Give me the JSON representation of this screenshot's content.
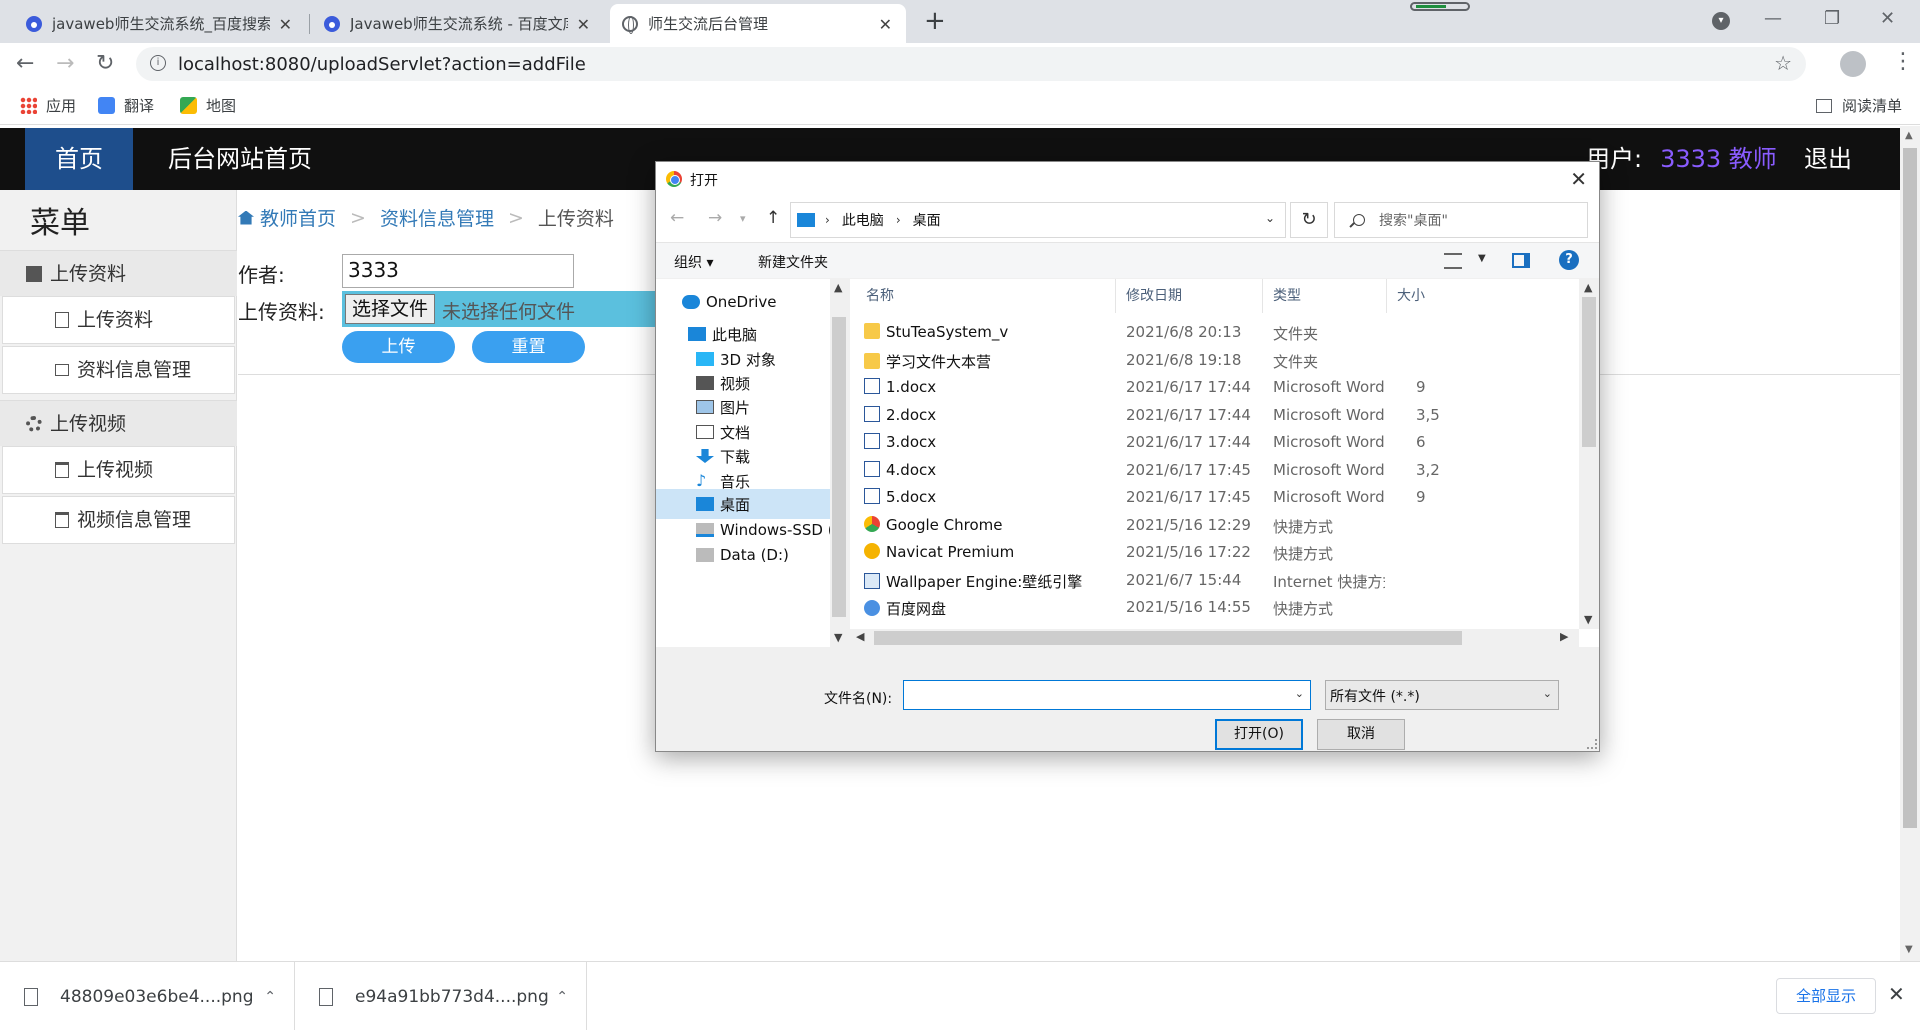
{
  "browser": {
    "tabs": [
      {
        "title": "javaweb师生交流系统_百度搜索",
        "close": "✕"
      },
      {
        "title": "Javaweb师生交流系统 - 百度文库",
        "close": "✕"
      },
      {
        "title": "师生交流后台管理",
        "close": "✕"
      }
    ],
    "new_tab": "+",
    "window_controls": {
      "minimize": "—",
      "restore": "❐",
      "close": "✕"
    },
    "url": "localhost:8080/uploadServlet?action=addFile",
    "bookmarks": [
      {
        "label": "应用",
        "icon": "apps-grid-icon"
      },
      {
        "label": "翻译",
        "icon": "translate-icon"
      },
      {
        "label": "地图",
        "icon": "maps-icon"
      }
    ],
    "reading_list": "阅读清单"
  },
  "page": {
    "nav": {
      "home": "首页",
      "admin_home": "后台网站首页",
      "user_label": "用户:",
      "user_value": "3333 教师",
      "logout": "退出"
    },
    "menu_title": "菜单",
    "menu": {
      "section1": "上传资料",
      "item_upload": "上传资料",
      "item_manage": "资料信息管理",
      "section2": "上传视频",
      "item_video_upload": "上传视频",
      "item_video_manage": "视频信息管理"
    },
    "breadcrumb": [
      "教师首页",
      "资料信息管理",
      "上传资料"
    ],
    "form": {
      "author_label": "作者:",
      "author_value": "3333",
      "file_label": "上传资料:",
      "choose_btn": "选择文件",
      "no_file": "未选择任何文件",
      "upload_btn": "上传",
      "reset_btn": "重置"
    }
  },
  "dialog": {
    "title": "打开",
    "path": [
      "此电脑",
      "桌面"
    ],
    "search_placeholder": "搜索\"桌面\"",
    "organize": "组织 ▾",
    "new_folder": "新建文件夹",
    "help": "?",
    "nav_tree": [
      {
        "label": "OneDrive",
        "icon": "onedrive-icon",
        "selected": false
      },
      {
        "label": "此电脑",
        "icon": "this-pc-icon",
        "selected": false
      },
      {
        "label": "3D 对象",
        "icon": "3d-objects-icon",
        "selected": false
      },
      {
        "label": "视频",
        "icon": "videos-icon",
        "selected": false
      },
      {
        "label": "图片",
        "icon": "pictures-icon",
        "selected": false
      },
      {
        "label": "文档",
        "icon": "documents-icon",
        "selected": false
      },
      {
        "label": "下载",
        "icon": "downloads-icon",
        "selected": false
      },
      {
        "label": "音乐",
        "icon": "music-icon",
        "selected": false
      },
      {
        "label": "桌面",
        "icon": "desktop-icon",
        "selected": true
      },
      {
        "label": "Windows-SSD (",
        "icon": "drive-c-icon",
        "selected": false
      },
      {
        "label": "Data (D:)",
        "icon": "drive-d-icon",
        "selected": false
      }
    ],
    "columns": {
      "name": "名称",
      "date": "修改日期",
      "type": "类型",
      "size": "大小"
    },
    "files": [
      {
        "name": "StuTeaSystem_v",
        "date": "2021/6/8 20:13",
        "type": "文件夹",
        "size": "",
        "icon": "folder"
      },
      {
        "name": "学习文件大本营",
        "date": "2021/6/8 19:18",
        "type": "文件夹",
        "size": "",
        "icon": "folder"
      },
      {
        "name": "1.docx",
        "date": "2021/6/17 17:44",
        "type": "Microsoft Word ...",
        "size": "9",
        "icon": "word"
      },
      {
        "name": "2.docx",
        "date": "2021/6/17 17:44",
        "type": "Microsoft Word ...",
        "size": "3,5",
        "icon": "word"
      },
      {
        "name": "3.docx",
        "date": "2021/6/17 17:44",
        "type": "Microsoft Word ...",
        "size": "6",
        "icon": "word"
      },
      {
        "name": "4.docx",
        "date": "2021/6/17 17:45",
        "type": "Microsoft Word ...",
        "size": "3,2",
        "icon": "word"
      },
      {
        "name": "5.docx",
        "date": "2021/6/17 17:45",
        "type": "Microsoft Word ...",
        "size": "9",
        "icon": "word"
      },
      {
        "name": "Google Chrome",
        "date": "2021/5/16 12:29",
        "type": "快捷方式",
        "size": "",
        "icon": "chrome"
      },
      {
        "name": "Navicat Premium",
        "date": "2021/5/16 17:22",
        "type": "快捷方式",
        "size": "",
        "icon": "navicat"
      },
      {
        "name": "Wallpaper Engine:壁纸引擎",
        "date": "2021/6/7 15:44",
        "type": "Internet 快捷方式",
        "size": "",
        "icon": "wall"
      },
      {
        "name": "百度网盘",
        "date": "2021/5/16 14:55",
        "type": "快捷方式",
        "size": "",
        "icon": "baidu"
      }
    ],
    "filename_label": "文件名(N):",
    "filename_value": "",
    "filetype": "所有文件 (*.*)",
    "open_btn": "打开(O)",
    "cancel_btn": "取消"
  },
  "downloads": {
    "items": [
      "48809e03e6be4....png",
      "e94a91bb773d4....png"
    ],
    "show_all": "全部显示",
    "close": "✕"
  }
}
